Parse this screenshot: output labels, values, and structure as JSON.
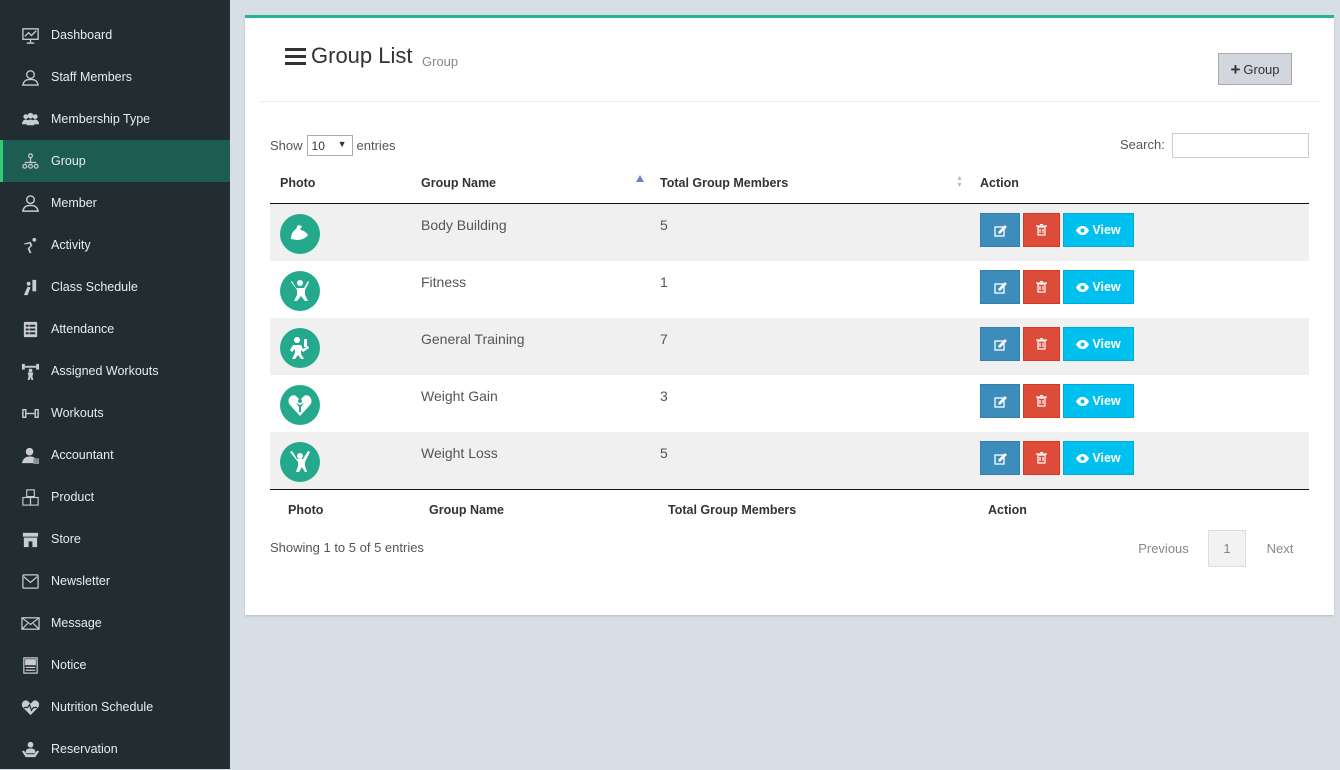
{
  "sidebar": {
    "items": [
      {
        "label": "Dashboard",
        "icon": "dashboard-icon"
      },
      {
        "label": "Staff Members",
        "icon": "staff-icon"
      },
      {
        "label": "Membership Type",
        "icon": "membership-icon"
      },
      {
        "label": "Group",
        "icon": "group-icon",
        "active": true
      },
      {
        "label": "Member",
        "icon": "member-icon"
      },
      {
        "label": "Activity",
        "icon": "activity-icon"
      },
      {
        "label": "Class Schedule",
        "icon": "class-schedule-icon"
      },
      {
        "label": "Attendance",
        "icon": "attendance-icon"
      },
      {
        "label": "Assigned Workouts",
        "icon": "assigned-workouts-icon"
      },
      {
        "label": "Workouts",
        "icon": "dumbbell-icon"
      },
      {
        "label": "Accountant",
        "icon": "accountant-icon"
      },
      {
        "label": "Product",
        "icon": "product-icon"
      },
      {
        "label": "Store",
        "icon": "store-icon"
      },
      {
        "label": "Newsletter",
        "icon": "newsletter-icon"
      },
      {
        "label": "Message",
        "icon": "message-icon"
      },
      {
        "label": "Notice",
        "icon": "notice-icon"
      },
      {
        "label": "Nutrition Schedule",
        "icon": "heart-icon"
      },
      {
        "label": "Reservation",
        "icon": "reservation-icon"
      }
    ]
  },
  "header": {
    "title": "Group List",
    "subtitle": "Group",
    "add_button": "Group"
  },
  "controls": {
    "show_label": "Show",
    "entries_value": "10",
    "entries_label": "entries",
    "search_label": "Search:",
    "search_value": ""
  },
  "table": {
    "columns": [
      "Photo",
      "Group Name",
      "Total Group Members",
      "Action"
    ],
    "rows": [
      {
        "name": "Body Building",
        "members": "5",
        "icon": "muscle-arm-icon"
      },
      {
        "name": "Fitness",
        "members": "1",
        "icon": "yoga-pose-icon"
      },
      {
        "name": "General Training",
        "members": "7",
        "icon": "training-icon"
      },
      {
        "name": "Weight Gain",
        "members": "3",
        "icon": "heart-person-icon"
      },
      {
        "name": "Weight Loss",
        "members": "5",
        "icon": "cheering-person-icon"
      }
    ],
    "view_label": "View"
  },
  "footer": {
    "info": "Showing 1 to 5 of 5 entries",
    "previous": "Previous",
    "page": "1",
    "next": "Next"
  },
  "colors": {
    "sidebar_bg": "#222d32",
    "active_bg": "#1d5c52",
    "accent": "#25b29a",
    "edit": "#3c8dbc",
    "delete": "#dd4b39",
    "view": "#00c0ef"
  }
}
